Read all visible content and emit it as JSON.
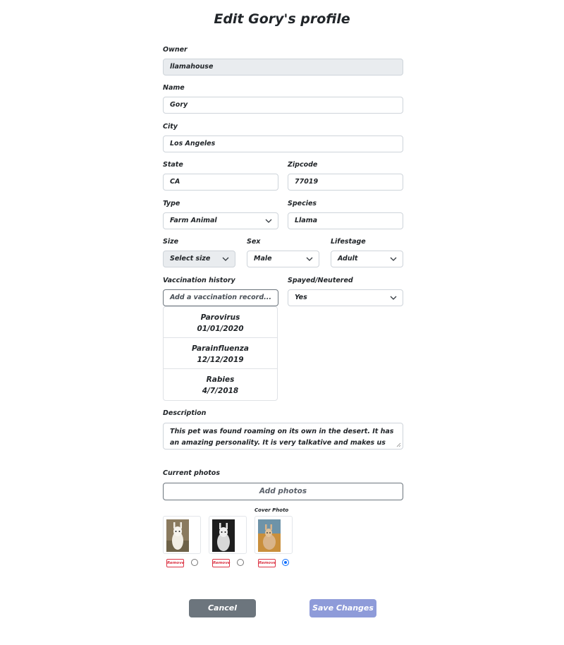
{
  "page_title": "Edit Gory's profile",
  "owner": {
    "label": "Owner",
    "value": "llamahouse"
  },
  "name": {
    "label": "Name",
    "value": "Gory"
  },
  "city": {
    "label": "City",
    "value": "Los Angeles"
  },
  "state": {
    "label": "State",
    "value": "CA"
  },
  "zipcode": {
    "label": "Zipcode",
    "value": "77019"
  },
  "type": {
    "label": "Type",
    "value": "Farm Animal"
  },
  "species": {
    "label": "Species",
    "value": "Llama"
  },
  "size": {
    "label": "Size",
    "value": "Select size"
  },
  "sex": {
    "label": "Sex",
    "value": "Male"
  },
  "lifestage": {
    "label": "Lifestage",
    "value": "Adult"
  },
  "vaccination": {
    "label": "Vaccination history",
    "placeholder": "Add a vaccination record...",
    "records": [
      {
        "name": "Parovirus",
        "date": "01/01/2020"
      },
      {
        "name": "Parainfluenza",
        "date": "12/12/2019"
      },
      {
        "name": "Rabies",
        "date": "4/7/2018"
      }
    ]
  },
  "spayed": {
    "label": "Spayed/Neutered",
    "value": "Yes"
  },
  "description": {
    "label": "Description",
    "value": "This pet was found roaming on its own in the desert.  It has an amazing personality.  It is very talkative and makes us laugh all the time with its incredible wit and charm. It loves grass and sun on warm days."
  },
  "photos": {
    "label": "Current photos",
    "add_label": "Add photos",
    "cover_label": "Cover Photo",
    "remove_label": "Remove",
    "cover_selected_index": 2
  },
  "actions": {
    "cancel": "Cancel",
    "save": "Save Changes"
  },
  "colors": {
    "cancel_bg": "#6c757d",
    "save_bg": "#8e9bd9",
    "remove": "#dc3545",
    "radio_checked": "#0d6efd",
    "readonly_bg": "#e9ecef"
  }
}
